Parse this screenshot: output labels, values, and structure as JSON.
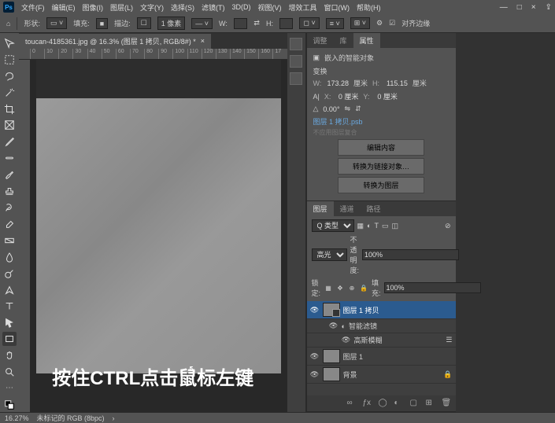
{
  "menu": {
    "items": [
      "文件(F)",
      "编辑(E)",
      "图像(I)",
      "图层(L)",
      "文字(Y)",
      "选择(S)",
      "滤镜(T)",
      "3D(D)",
      "视图(V)",
      "增效工具",
      "窗口(W)",
      "帮助(H)"
    ]
  },
  "win": {
    "min": "—",
    "max": "□",
    "close": "×",
    "share": "⇪"
  },
  "options": {
    "shape_label": "形状:",
    "fill_label": "填充:",
    "fill_value": "1 像素",
    "stroke_label": "描边:",
    "w_label": "W:",
    "h_label": "H:",
    "align_label": "对齐边缘"
  },
  "tab": {
    "title": "toucan-4185361.jpg @ 16.3% (图层 1 拷贝, RGB/8#) *",
    "close": "×"
  },
  "ruler": [
    "0",
    "10",
    "20",
    "30",
    "40",
    "50",
    "60",
    "70",
    "80",
    "90",
    "100",
    "110",
    "120",
    "130",
    "140",
    "150",
    "160",
    "17"
  ],
  "overlay": "按住CTRL点击鼠标左键",
  "panels": {
    "top_tabs": [
      "调整",
      "库",
      "属性"
    ],
    "props": {
      "icon_label": "嵌入的智能对象",
      "transform_label": "变换",
      "w_label": "W:",
      "w_val": "173.28",
      "w_unit": "厘米",
      "h_label": "H:",
      "h_val": "115.15",
      "h_unit": "厘米",
      "x_label": "X:",
      "x_val": "0 厘米",
      "y_label": "Y:",
      "y_val": "0 厘米",
      "angle": "0.00°",
      "filename": "图层 1 拷贝.psb",
      "reset_note": "不应用图层复合",
      "btn_edit": "编辑内容",
      "btn_convert": "转换为链接对象…",
      "btn_raster": "转换为图层"
    },
    "layers_tabs": [
      "图层",
      "通道",
      "路径"
    ],
    "layers": {
      "kind": "Q 类型",
      "blend": "高光",
      "opacity_label": "不透明度:",
      "opacity": "100%",
      "lock_label": "锁定:",
      "fill_label": "填充:",
      "fill": "100%",
      "items": [
        {
          "name": "图层 1 拷贝",
          "visible": true,
          "active": true,
          "smart": true,
          "indent": 0
        },
        {
          "name": "智能滤镜",
          "visible": true,
          "active": false,
          "smart": false,
          "indent": 1,
          "collapse": "◐"
        },
        {
          "name": "高斯模糊",
          "visible": true,
          "active": false,
          "smart": false,
          "indent": 2
        },
        {
          "name": "图层 1",
          "visible": true,
          "active": false,
          "smart": false,
          "indent": 0
        },
        {
          "name": "背景",
          "visible": true,
          "active": false,
          "smart": false,
          "indent": 0,
          "locked": true
        }
      ]
    }
  },
  "status": {
    "zoom": "16.27%",
    "info": "未标记的 RGB (8bpc)"
  }
}
